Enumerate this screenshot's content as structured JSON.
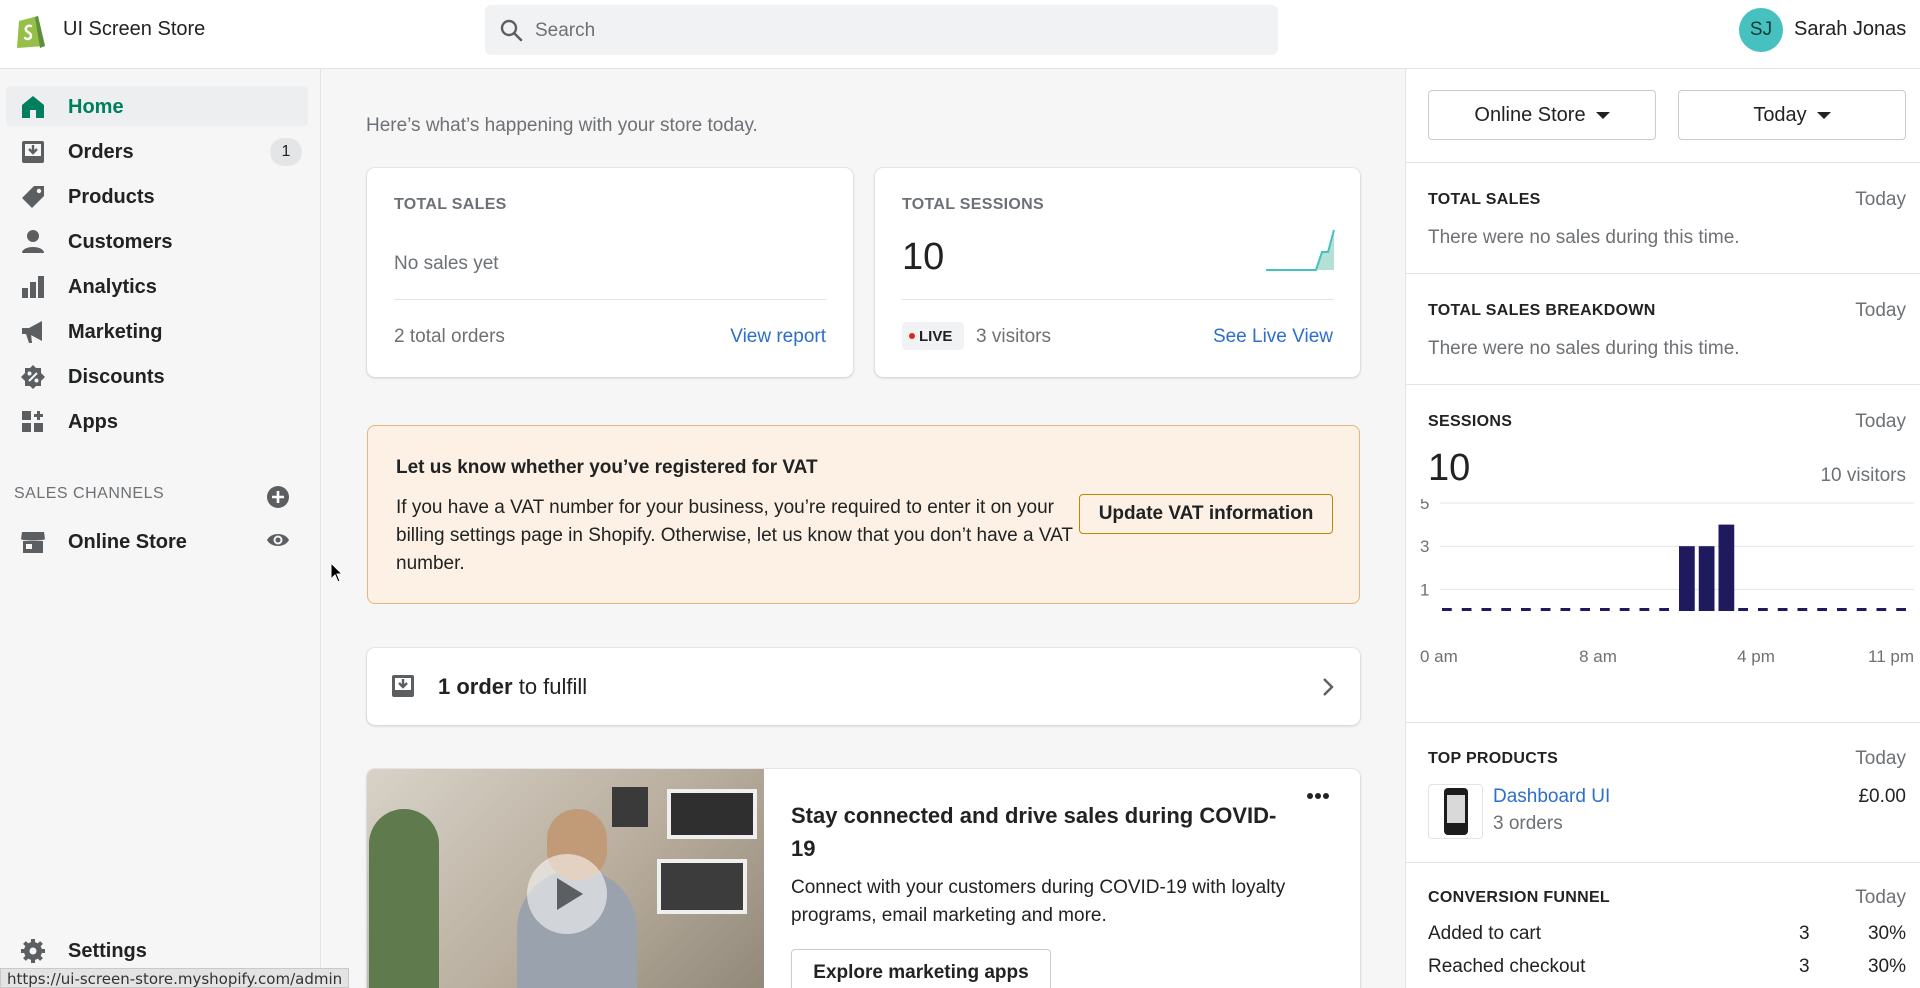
{
  "header": {
    "store_name": "UI Screen Store",
    "search_placeholder": "Search",
    "user_initials": "SJ",
    "user_name": "Sarah Jonas"
  },
  "sidebar": {
    "items": [
      {
        "label": "Home",
        "icon": "home-icon",
        "active": true
      },
      {
        "label": "Orders",
        "icon": "orders-icon",
        "badge": "1"
      },
      {
        "label": "Products",
        "icon": "tag-icon"
      },
      {
        "label": "Customers",
        "icon": "person-icon"
      },
      {
        "label": "Analytics",
        "icon": "bar-chart-icon"
      },
      {
        "label": "Marketing",
        "icon": "megaphone-icon"
      },
      {
        "label": "Discounts",
        "icon": "discount-icon"
      },
      {
        "label": "Apps",
        "icon": "apps-icon"
      }
    ],
    "sales_channels_title": "SALES CHANNELS",
    "channels": [
      {
        "label": "Online Store",
        "icon": "store-icon"
      }
    ],
    "settings_label": "Settings",
    "status_url": "https://ui-screen-store.myshopify.com/admin"
  },
  "main": {
    "intro": "Here’s what’s happening with your store today.",
    "total_sales": {
      "title": "TOTAL SALES",
      "empty_text": "No sales yet",
      "orders_text": "2 total orders",
      "link": "View report"
    },
    "total_sessions": {
      "title": "TOTAL SESSIONS",
      "value": "10",
      "live_label": "LIVE",
      "visitors_text": "3 visitors",
      "link": "See Live View"
    },
    "vat": {
      "title": "Let us know whether you’ve registered for VAT",
      "body": "If you have a VAT number for your business, you’re required to enter it on your billing settings page in Shopify. Otherwise, let us know that you don’t have a VAT number.",
      "button": "Update VAT information"
    },
    "fulfill": {
      "count_text": "1 order",
      "rest_text": " to fulfill"
    },
    "promo": {
      "title": "Stay connected and drive sales during COVID-19",
      "body": "Connect with your customers during COVID-19 with loyalty programs, email marketing and more.",
      "button": "Explore marketing apps"
    }
  },
  "right_panel": {
    "channel_select": "Online Store",
    "date_select": "Today",
    "total_sales": {
      "title": "TOTAL SALES",
      "period": "Today",
      "text": "There were no sales during this time."
    },
    "breakdown": {
      "title": "TOTAL SALES BREAKDOWN",
      "period": "Today",
      "text": "There were no sales during this time."
    },
    "sessions": {
      "title": "SESSIONS",
      "period": "Today",
      "value": "10",
      "visitors": "10 visitors"
    },
    "top_products": {
      "title": "TOP PRODUCTS",
      "period": "Today",
      "product_name": "Dashboard UI",
      "product_orders": "3 orders",
      "product_price": "£0.00"
    },
    "conversion": {
      "title": "CONVERSION FUNNEL",
      "period": "Today",
      "rows": [
        {
          "label": "Added to cart",
          "count": "3",
          "pct": "30%"
        },
        {
          "label": "Reached checkout",
          "count": "3",
          "pct": "30%"
        }
      ]
    }
  },
  "chart_data": {
    "type": "bar",
    "title": "",
    "x_ticks": [
      "0 am",
      "8 am",
      "4 pm",
      "11 pm"
    ],
    "y_ticks": [
      "1",
      "3",
      "5"
    ],
    "categories": [
      "0",
      "1",
      "2",
      "3",
      "4",
      "5",
      "6",
      "7",
      "8",
      "9",
      "10",
      "11",
      "12",
      "13",
      "14",
      "15",
      "16",
      "17",
      "18",
      "19",
      "20",
      "21",
      "22",
      "23"
    ],
    "values": [
      0,
      0,
      0,
      0,
      0,
      0,
      0,
      0,
      0,
      0,
      0,
      0,
      3,
      3,
      4,
      0,
      0,
      0,
      0,
      0,
      0,
      0,
      0,
      0
    ],
    "ylim": [
      0,
      5
    ],
    "color": "#1f1a5e"
  },
  "colors": {
    "accent": "#007f5f",
    "link": "#2c6ecb",
    "bar": "#1f1a5e",
    "live": "#d82c0d",
    "vat_bg": "#fcf1e4"
  }
}
